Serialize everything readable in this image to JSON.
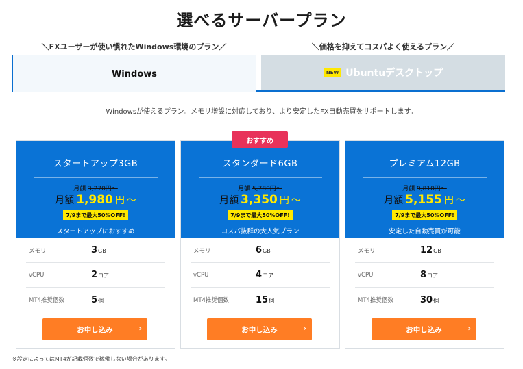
{
  "page": {
    "title": "選べるサーバープラン",
    "description": "Windowsが使えるプラン。メモリ増設に対応しており、より安定したFX自動売買をサポートします。",
    "footnote": "※設定によってはMT4が記載個数で稼働しない場合があります。"
  },
  "tabs": {
    "windows_caption": "＼FXユーザーが使い慣れたWindows環境のプラン／",
    "ubuntu_caption": "＼価格を抑えてコスパよく使えるプラン／",
    "windows_label": "Windows",
    "ubuntu_badge": "NEW",
    "ubuntu_label": "Ubuntuデスクトップ"
  },
  "recommend_badge": "おすすめ",
  "colors": {
    "primary": "#0a73d6",
    "accent_yellow": "#ffe800",
    "cta_orange": "#ff7d24",
    "recommend_pink": "#e8325a"
  },
  "plans": [
    {
      "name": "スタートアップ3GB",
      "old_label": "月額 ",
      "old_price": "3,270円〜",
      "price_label": "月額",
      "price": "1,980",
      "price_unit": "円",
      "tilde": "〜",
      "discount": "7/9まで最大50%OFF!",
      "tagline": "スタートアップにおすすめ",
      "specs": [
        {
          "label": "メモリ",
          "value": "3",
          "unit": "GB"
        },
        {
          "label": "vCPU",
          "value": "2",
          "unit": "コア"
        },
        {
          "label": "MT4推奨個数",
          "value": "5",
          "unit": "個"
        }
      ],
      "cta": "お申し込み"
    },
    {
      "name": "スタンダード6GB",
      "old_label": "月額 ",
      "old_price": "5,780円〜",
      "price_label": "月額",
      "price": "3,350",
      "price_unit": "円",
      "tilde": "〜",
      "discount": "7/9まで最大50%OFF!",
      "tagline": "コスパ抜群の大人気プラン",
      "specs": [
        {
          "label": "メモリ",
          "value": "6",
          "unit": "GB"
        },
        {
          "label": "vCPU",
          "value": "4",
          "unit": "コア"
        },
        {
          "label": "MT4推奨個数",
          "value": "15",
          "unit": "個"
        }
      ],
      "cta": "お申し込み"
    },
    {
      "name": "プレミアム12GB",
      "old_label": "月額 ",
      "old_price": "9,810円〜",
      "price_label": "月額",
      "price": "5,155",
      "price_unit": "円",
      "tilde": "〜",
      "discount": "7/9まで最大50%OFF!",
      "tagline": "安定した自動売買が可能",
      "specs": [
        {
          "label": "メモリ",
          "value": "12",
          "unit": "GB"
        },
        {
          "label": "vCPU",
          "value": "8",
          "unit": "コア"
        },
        {
          "label": "MT4推奨個数",
          "value": "30",
          "unit": "個"
        }
      ],
      "cta": "お申し込み"
    }
  ]
}
